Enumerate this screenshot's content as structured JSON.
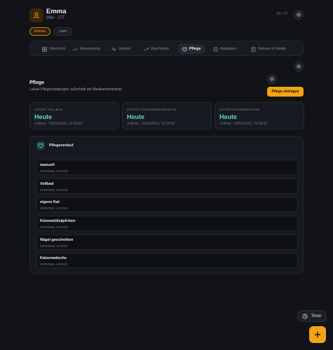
{
  "header": {
    "name": "Emma",
    "subtitle": "39w · 27T",
    "counter": "29 / 27"
  },
  "users": [
    {
      "label": "Emma",
      "active": true
    },
    {
      "label": "Liam",
      "active": false
    }
  ],
  "tabs": [
    {
      "label": "Übersicht",
      "icon": "grid-icon"
    },
    {
      "label": "Auswertung",
      "icon": "trend-icon"
    },
    {
      "label": "Verlauf",
      "icon": "pulse-icon"
    },
    {
      "label": "Wachstum",
      "icon": "growth-icon"
    },
    {
      "label": "Pflege",
      "icon": "heart-icon",
      "active": true
    },
    {
      "label": "Aufgaben",
      "icon": "clipboard-icon"
    },
    {
      "label": "Notizen & Medis",
      "icon": "notes-icon"
    }
  ],
  "section": {
    "title": "Pflege",
    "description": "Lokale Pflegehandlungen außerhalb der Medikamentenliste",
    "add_button": "Pflege eintragen"
  },
  "cards": [
    {
      "label": "Letzte Vollbad",
      "value": "Heute",
      "sub": "Vollbad · 03/09/2026, 19:28:00"
    },
    {
      "label": "Letzte Ganzkörperwäsche",
      "value": "Heute",
      "sub": "Vollbad · 03/09/2026, 19:28:00"
    },
    {
      "label": "Letzte Katzenwäsche",
      "value": "Heute",
      "sub": "Vollbad · 03/09/2026, 19:28:00"
    }
  ],
  "history": {
    "title": "Pflegeverlauf",
    "entries": [
      {
        "title": "manuell",
        "date": "03/09/2026, 19:29:00"
      },
      {
        "title": "Vollbad",
        "date": "03/09/2026, 19:28:00"
      },
      {
        "title": "eigene Kat",
        "date": "03/09/2026, 19:28:00"
      },
      {
        "title": "Kümmelölzäpfchen",
        "date": "02/09/2026, 19:28:00"
      },
      {
        "title": "Nägel geschnitten",
        "date": "02/09/2026, 19:28:00"
      },
      {
        "title": "Katzenwäsche",
        "date": "01/09/2026, 19:28:00"
      }
    ]
  },
  "floating": {
    "timer_label": "Timer"
  },
  "colors": {
    "accent": "#f2a316",
    "teal": "#5fd7c8",
    "background": "#121318"
  }
}
